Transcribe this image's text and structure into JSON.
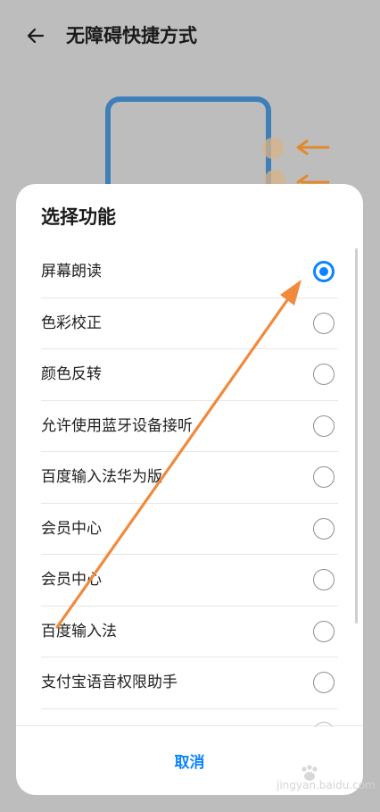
{
  "header": {
    "title": "无障碍快捷方式",
    "back_icon": "arrow-left-icon"
  },
  "sheet": {
    "title": "选择功能",
    "options": [
      {
        "label": "屏幕朗读",
        "selected": true
      },
      {
        "label": "色彩校正",
        "selected": false
      },
      {
        "label": "颜色反转",
        "selected": false
      },
      {
        "label": "允许使用蓝牙设备接听",
        "selected": false
      },
      {
        "label": "百度输入法华为版",
        "selected": false
      },
      {
        "label": "会员中心",
        "selected": false
      },
      {
        "label": "会员中心",
        "selected": false
      },
      {
        "label": "百度输入法",
        "selected": false
      },
      {
        "label": "支付宝语音权限助手",
        "selected": false
      }
    ],
    "cancel_label": "取消"
  },
  "colors": {
    "accent": "#0a84ff",
    "annotation_arrow": "#f08a3c",
    "illustration_frame": "#3f7fb8",
    "scrim": "#bdbdbd"
  },
  "watermark": {
    "text": "jingyan.baidu.com"
  }
}
